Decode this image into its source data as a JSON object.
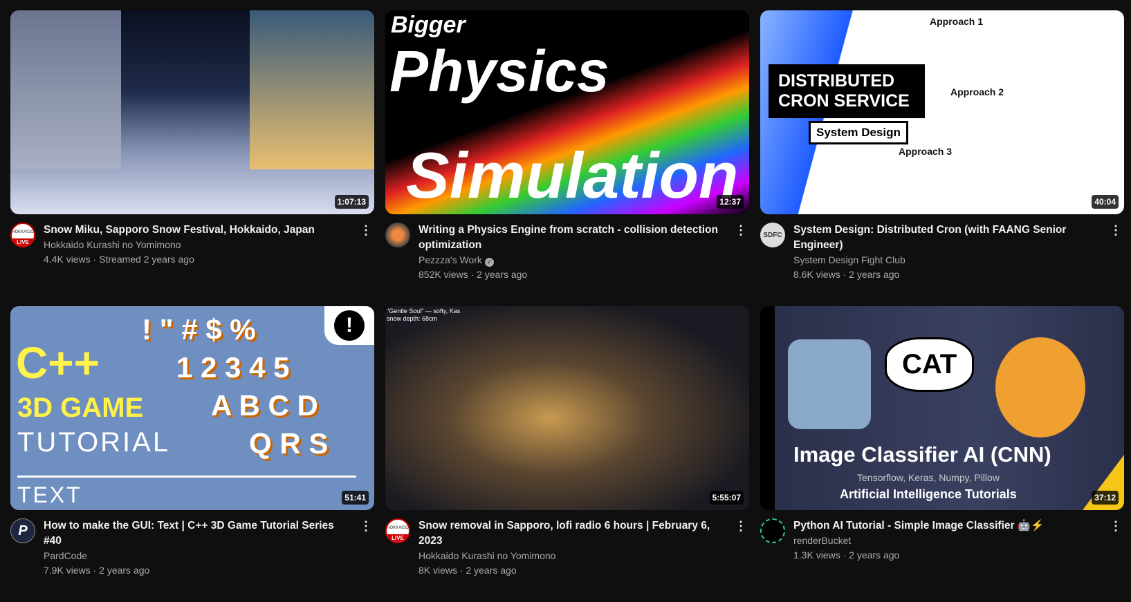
{
  "videos": [
    {
      "title": "Snow Miku, Sapporo Snow Festival, Hokkaido, Japan",
      "channel": "Hokkaido Kurashi no Yomimono",
      "stats": "4.4K views · Streamed 2 years ago",
      "duration": "1:07:13",
      "avatar_badge": "LIVE",
      "avatar_text": "HOKKAIDO"
    },
    {
      "title": "Writing a Physics Engine from scratch - collision detection optimization",
      "channel": "Pezzza's Work",
      "verified": true,
      "stats": "852K views · 2 years ago",
      "duration": "12:37",
      "thumb_text": [
        "Bigger",
        "Physics",
        "Simulation"
      ]
    },
    {
      "title": "System Design: Distributed Cron (with FAANG Senior Engineer)",
      "channel": "System Design Fight Club",
      "stats": "8.6K views · 2 years ago",
      "duration": "40:04",
      "avatar_text": "SDFC",
      "thumb_text": [
        "DISTRIBUTED",
        "CRON SERVICE",
        "System Design",
        "Approach 1",
        "Approach 2",
        "Approach 3"
      ]
    },
    {
      "title": "How to make the GUI: Text | C++ 3D Game Tutorial Series #40",
      "channel": "PardCode",
      "stats": "7.9K views · 2 years ago",
      "duration": "51:41",
      "avatar_text": "P",
      "thumb_text": [
        "C++",
        "3D GAME",
        "TUTORIAL",
        "TEXT",
        "! \" # $ %",
        "1 2 3 4 5",
        "A B C D",
        "Q R S"
      ]
    },
    {
      "title": "Snow removal in Sapporo, lofi radio 6 hours  | February 6, 2023",
      "channel": "Hokkaido Kurashi no Yomimono",
      "stats": "8K views · 2 years ago",
      "duration": "5:55:07",
      "avatar_badge": "LIVE",
      "avatar_text": "HOKKAIDO",
      "thumb_text": [
        "\"Gentle Soul\" — softy, Kas",
        "snow depth: 68cm"
      ]
    },
    {
      "title": "Python AI Tutorial - Simple Image Classifier 🤖⚡",
      "channel": "renderBucket",
      "stats": "1.3K views · 2 years ago",
      "duration": "37:12",
      "thumb_text": [
        "CAT",
        "Image Classifier AI (CNN)",
        "Tensorflow, Keras, Numpy, Pillow",
        "Artificial Intelligence Tutorials"
      ]
    }
  ]
}
